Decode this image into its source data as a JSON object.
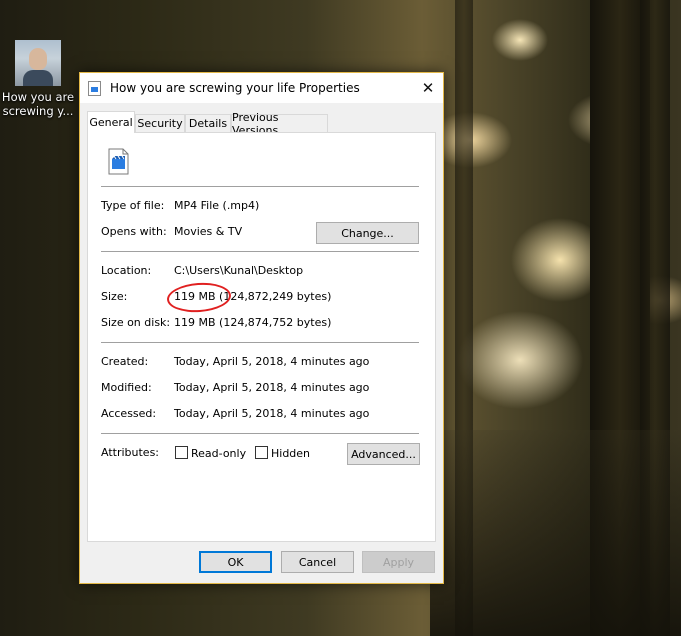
{
  "desktop": {
    "icon_label": "How you are screwing y..."
  },
  "dialog": {
    "title": "How you are screwing your life Properties",
    "tabs": [
      {
        "label": "General"
      },
      {
        "label": "Security"
      },
      {
        "label": "Details"
      },
      {
        "label": "Previous Versions"
      }
    ],
    "general": {
      "type_label": "Type of file:",
      "type_value": "MP4 File (.mp4)",
      "opens_label": "Opens with:",
      "opens_value": "Movies & TV",
      "change_button": "Change...",
      "location_label": "Location:",
      "location_value": "C:\\Users\\Kunal\\Desktop",
      "size_label": "Size:",
      "size_value": "119 MB (124,872,249 bytes)",
      "size_on_disk_label": "Size on disk:",
      "size_on_disk_value": "119 MB (124,874,752 bytes)",
      "created_label": "Created:",
      "created_value": "Today, April 5, 2018, 4 minutes ago",
      "modified_label": "Modified:",
      "modified_value": "Today, April 5, 2018, 4 minutes ago",
      "accessed_label": "Accessed:",
      "accessed_value": "Today, April 5, 2018, 4 minutes ago",
      "attributes_label": "Attributes:",
      "readonly_label": "Read-only",
      "hidden_label": "Hidden",
      "advanced_button": "Advanced..."
    },
    "buttons": {
      "ok": "OK",
      "cancel": "Cancel",
      "apply": "Apply"
    },
    "close_glyph": "✕"
  },
  "colors": {
    "accent": "#0078d7",
    "annotation": "#e02020",
    "window_border": "#e3b847"
  }
}
